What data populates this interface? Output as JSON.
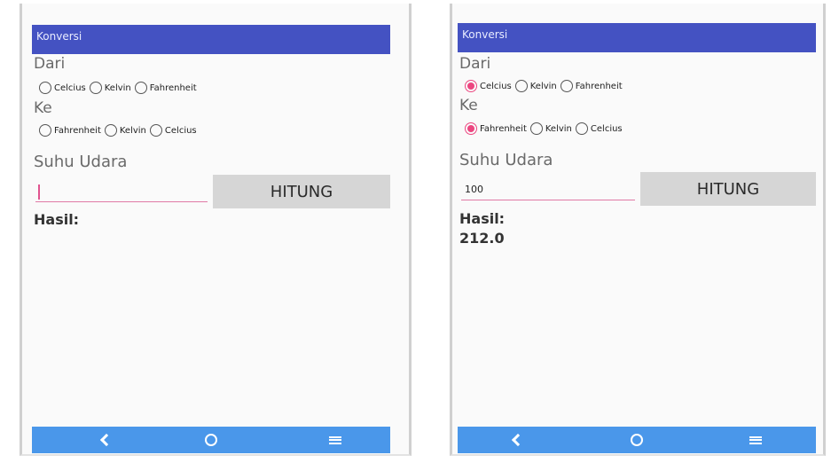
{
  "screens": [
    {
      "app_title": "Konversi",
      "dari_label": "Dari",
      "dari_options": [
        {
          "label": "Celcius",
          "checked": false
        },
        {
          "label": "Kelvin",
          "checked": false
        },
        {
          "label": "Fahrenheit",
          "checked": false
        }
      ],
      "ke_label": "Ke",
      "ke_options": [
        {
          "label": "Fahrenheit",
          "checked": false
        },
        {
          "label": "Kelvin",
          "checked": false
        },
        {
          "label": "Celcius",
          "checked": false
        }
      ],
      "suhu_label": "Suhu Udara",
      "suhu_value": "",
      "hitung_label": "HITUNG",
      "hasil_label": "Hasil:",
      "hasil_value": ""
    },
    {
      "app_title": "Konversi",
      "dari_label": "Dari",
      "dari_options": [
        {
          "label": "Celcius",
          "checked": true
        },
        {
          "label": "Kelvin",
          "checked": false
        },
        {
          "label": "Fahrenheit",
          "checked": false
        }
      ],
      "ke_label": "Ke",
      "ke_options": [
        {
          "label": "Fahrenheit",
          "checked": true
        },
        {
          "label": "Kelvin",
          "checked": false
        },
        {
          "label": "Celcius",
          "checked": false
        }
      ],
      "suhu_label": "Suhu Udara",
      "suhu_value": "100",
      "hitung_label": "HITUNG",
      "hasil_label": "Hasil:",
      "hasil_value": "212.0"
    }
  ],
  "navbar": {
    "back_icon": "back-chevron-icon",
    "home_icon": "home-circle-icon",
    "menu_icon": "menu-lines-icon"
  },
  "colors": {
    "appbar": "#4452c2",
    "navbar": "#4a97ea",
    "accent": "#ec4680",
    "button": "#d6d6d6"
  }
}
